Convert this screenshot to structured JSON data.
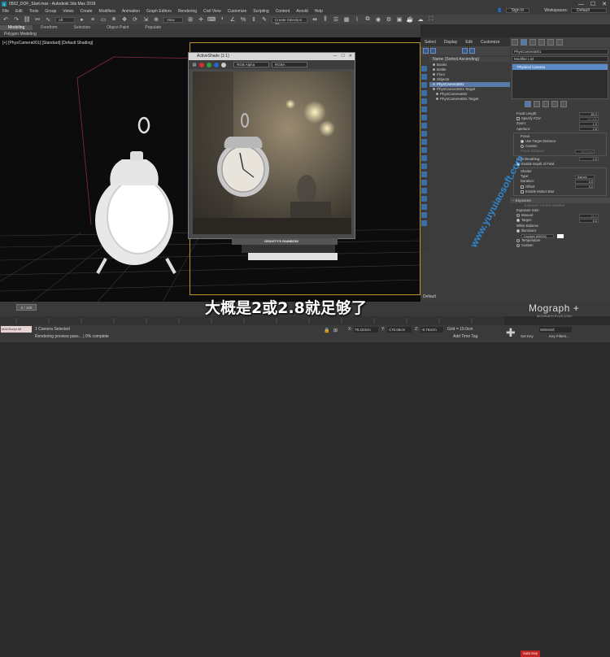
{
  "window": {
    "title": "0502_DOF_Start.max - Autodesk 3ds Max 2018"
  },
  "menu": {
    "items": [
      "File",
      "Edit",
      "Tools",
      "Group",
      "Views",
      "Create",
      "Modifiers",
      "Animation",
      "Graph Editors",
      "Rendering",
      "Civil View",
      "Customize",
      "Scripting",
      "Content",
      "Arnold",
      "Help"
    ],
    "signin": "Sign In",
    "workspaces_label": "Workspaces:",
    "workspace_value": "Default"
  },
  "toolbar": {
    "filter": "All",
    "view": "View",
    "selection_set": "Create Selection Se"
  },
  "ribbon": {
    "tabs": [
      "Modeling",
      "Freeform",
      "Selection",
      "Object Paint",
      "Populate"
    ],
    "sub": "Polygon Modeling"
  },
  "viewport": {
    "label": "[+] [PhysCamera001] [Standard] [Default Shading]"
  },
  "activeshade": {
    "title": "ActiveShade (1:1)",
    "channel": "RGB Alpha",
    "mode": "RGBA",
    "book_text": "GRAVITY'S RAINBOW"
  },
  "scene": {
    "tabs": [
      "Select",
      "Display",
      "Edit",
      "Customize"
    ],
    "header": "Name (Sorted Ascending)",
    "items": [
      {
        "name": "Books",
        "selected": false,
        "indent": 1
      },
      {
        "name": "Bottle",
        "selected": false,
        "indent": 1
      },
      {
        "name": "Floor",
        "selected": false,
        "indent": 1
      },
      {
        "name": "Objects",
        "selected": false,
        "indent": 1
      },
      {
        "name": "PhysCamera001",
        "selected": true,
        "indent": 1
      },
      {
        "name": "PhysCamera001.Target",
        "selected": false,
        "indent": 1
      },
      {
        "name": "PhysCamera002",
        "selected": false,
        "indent": 2
      },
      {
        "name": "PhysCamera002.Target",
        "selected": false,
        "indent": 2
      }
    ],
    "default_label": "Default"
  },
  "modify": {
    "object_name": "PhysCamera001",
    "modifier_list": "Modifier List",
    "stack_item": "Physical Camera",
    "lens": {
      "focal_length_label": "Focal Length:",
      "focal_length": "80.0",
      "specify_fov": "Specify FOV:",
      "fov": "25.406",
      "zoom_label": "Zoom:",
      "zoom": "1.0",
      "aperture_label": "Aperture:",
      "aperture": "2.8",
      "focus_label": "Focus",
      "use_target": "Use Target Distance",
      "custom": "Custom",
      "focus_distance_label": "Focus Distance:",
      "focus_distance": "300.0cm",
      "lens_breathing_label": "Lens Breathing:",
      "lens_breathing": "1.0",
      "enable_dof": "Enable Depth of Field"
    },
    "shutter": {
      "title": "Shutter",
      "type_label": "Type:",
      "type": "frames",
      "duration_label": "Duration:",
      "duration": "0.5",
      "offset_label": "Offset:",
      "offset": "0.0",
      "enable_motion_blur": "Enable Motion Blur"
    },
    "exposure": {
      "title": "Exposure",
      "control": "Exposure Control Installed",
      "gain": "Exposure Gain",
      "manual": "Manual:",
      "manual_val": "80.0",
      "target": "Target:",
      "target_val": "6.0",
      "ev": "EV",
      "wb": "White Balance",
      "illuminant": "Illuminant",
      "daylight": "Daylight (6500K)",
      "temperature": "Temperature",
      "temp_val": "6500.0",
      "custom": "Custom"
    }
  },
  "timeline": {
    "frame": "0 / 100"
  },
  "status": {
    "selected": "1 Camera Selected",
    "message": "Rendering preview pass... | 0% complete",
    "maxscript": "MAXScript Mi",
    "x": "78.423cm",
    "y": "-176.66cm",
    "z": "-8.754cm",
    "grid": "Grid = 10.0cm",
    "add_time_tag": "Add Time Tag",
    "auto_key": "Auto Key",
    "set_key": "Set Key",
    "selected_dd": "Selected",
    "key_filters": "Key Filters..."
  },
  "subtitle": "大概是2或2.8就足够了",
  "watermark": "www.yuyuiaosoft.com",
  "brand": {
    "name": "Mograph",
    "sub": "MOGRAPH PLUS.COM"
  }
}
